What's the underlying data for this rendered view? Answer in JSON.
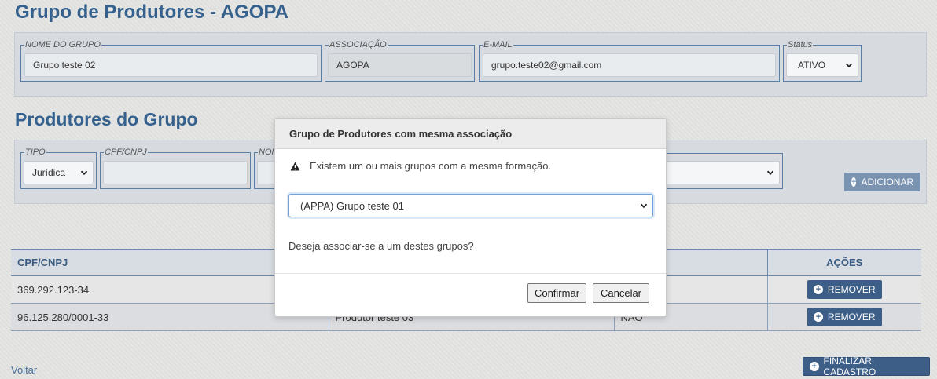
{
  "page": {
    "title": "Grupo de Produtores - AGOPA"
  },
  "group_form": {
    "nome_label": "NOME DO GRUPO",
    "nome_value": "Grupo teste 02",
    "assoc_label": "ASSOCIAÇÃO",
    "assoc_value": "AGOPA",
    "email_label": "E-MAIL",
    "email_value": "grupo.teste02@gmail.com",
    "status_label": "Status",
    "status_value": "ATIVO"
  },
  "producers_section": {
    "title": "Produtores do Grupo",
    "tipo_label": "TIPO",
    "tipo_value": "Jurídica",
    "cpf_label": "CPF/CNPJ",
    "cpf_value": "",
    "nome_label_partial": "NOM",
    "add_button": "ADICIONAR"
  },
  "table": {
    "headers": [
      "CPF/CNPJ",
      "",
      "",
      "AÇÕES"
    ],
    "rows": [
      {
        "cpf": "369.292.123-34",
        "nome": "",
        "ativo": "",
        "action": "REMOVER"
      },
      {
        "cpf": "96.125.280/0001-33",
        "nome": "Produtor teste 03",
        "ativo": "NÃO",
        "action": "REMOVER"
      }
    ]
  },
  "footer": {
    "back_link": "Voltar",
    "finish_button": "FINALIZAR CADASTRO"
  },
  "modal": {
    "title": "Grupo de Produtores com mesma associação",
    "message": "Existem um ou mais grupos com a mesma formação.",
    "select_value": "(APPA) Grupo teste 01",
    "question": "Deseja associar-se a um destes grupos?",
    "confirm": "Confirmar",
    "cancel": "Cancelar"
  },
  "icons": {
    "chevron": "chevron-down-icon",
    "plus": "plus-circle-icon",
    "warning": "warning-icon"
  },
  "colors": {
    "accent": "#35618f",
    "button_blue": "#3d5f87",
    "add_button_muted": "#7a93b1"
  }
}
